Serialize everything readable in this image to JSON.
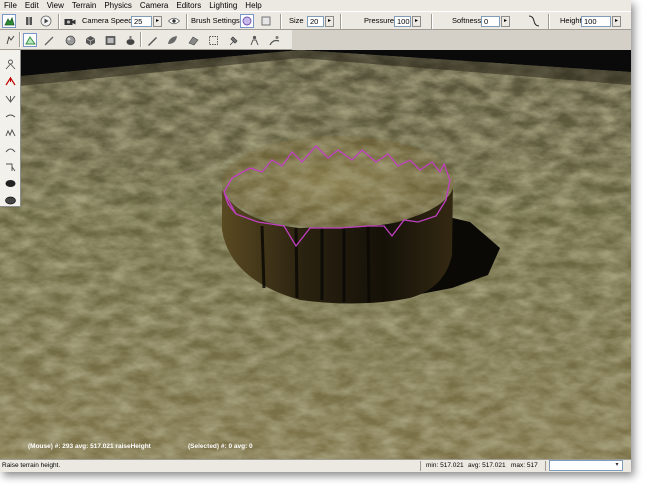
{
  "menu": [
    "File",
    "Edit",
    "View",
    "Terrain",
    "Physics",
    "Camera",
    "Editors",
    "Lighting",
    "Help"
  ],
  "toolbar": {
    "camera_speed_label": "Camera Speed",
    "camera_speed_value": "25",
    "brush_settings_label": "Brush Settings",
    "size_label": "Size",
    "size_value": "20",
    "pressure_label": "Pressure",
    "pressure_value": "100",
    "softness_label": "Softness",
    "softness_value": "0",
    "height_label": "Height",
    "height_value": "100",
    "spin_arrow": "▸"
  },
  "toolbar_icons_row1": [
    "terrain-editor-icon",
    "pause-icon",
    "play-icon"
  ],
  "toolbar_icons_row2": [
    "terrain-editor-icon",
    "paint-brush-icon",
    "sphere-icon",
    "cube-icon",
    "image-icon",
    "mesh-icon",
    "shape-icon",
    "leaf-icon",
    "material-icon",
    "pen-icon",
    "bucket-icon",
    "select-box-icon",
    "tool-icon",
    "character-icon",
    "road-icon",
    "paint-icon"
  ],
  "palette_icons": [
    "grab-icon",
    "raise-height-icon",
    "lower-height-icon",
    "smooth-icon",
    "noise-icon",
    "flatten-icon",
    "set-height-icon",
    "fill-hole-icon",
    "clear-icon"
  ],
  "overlay": {
    "mouse_info": "(Mouse) #: 293  avg: 517.021 raiseHeight",
    "selected_info": "(Selected) #: 0  avg: 0"
  },
  "status": {
    "message": "Raise terrain height.",
    "min": "min: 517.021",
    "avg": "avg: 517.021",
    "max": "max: 517",
    "dropdown_arrow": "▾"
  },
  "colors": {
    "selection_outline": "#c040c0",
    "active_tool": "#c00000"
  }
}
